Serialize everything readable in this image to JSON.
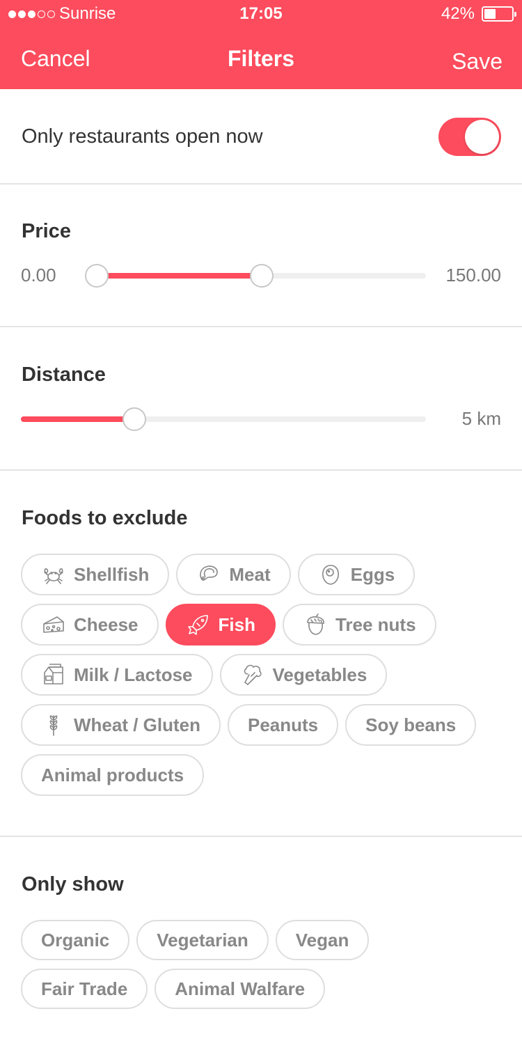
{
  "status_bar": {
    "carrier": "Sunrise",
    "time": "17:05",
    "battery": "42%",
    "battery_level": 0.42,
    "signal_bars_filled": 3,
    "signal_bars_total": 5
  },
  "nav": {
    "cancel": "Cancel",
    "title": "Filters",
    "save": "Save"
  },
  "open_now": {
    "label": "Only restaurants open now",
    "enabled": true
  },
  "price": {
    "title": "Price",
    "min_label": "0.00",
    "max_label": "150.00",
    "range_min": 0,
    "range_max": 150,
    "selected_low": 0,
    "selected_high": 75
  },
  "distance": {
    "title": "Distance",
    "value_label": "5 km",
    "level": 0.28
  },
  "foods_to_exclude": {
    "title": "Foods to exclude",
    "items": [
      {
        "label": "Shellfish",
        "icon": "crab-icon",
        "selected": false
      },
      {
        "label": "Meat",
        "icon": "steak-icon",
        "selected": false
      },
      {
        "label": "Eggs",
        "icon": "egg-icon",
        "selected": false
      },
      {
        "label": "Cheese",
        "icon": "cheese-icon",
        "selected": false
      },
      {
        "label": "Fish",
        "icon": "fish-icon",
        "selected": true
      },
      {
        "label": "Tree nuts",
        "icon": "acorn-icon",
        "selected": false
      },
      {
        "label": "Milk / Lactose",
        "icon": "milk-carton-icon",
        "selected": false
      },
      {
        "label": "Vegetables",
        "icon": "broccoli-icon",
        "selected": false
      },
      {
        "label": "Wheat / Gluten",
        "icon": "wheat-icon",
        "selected": false
      },
      {
        "label": "Peanuts",
        "icon": "",
        "selected": false
      },
      {
        "label": "Soy beans",
        "icon": "",
        "selected": false
      },
      {
        "label": "Animal products",
        "icon": "",
        "selected": false
      }
    ]
  },
  "only_show": {
    "title": "Only show",
    "items": [
      {
        "label": "Organic",
        "selected": false
      },
      {
        "label": "Vegetarian",
        "selected": false
      },
      {
        "label": "Vegan",
        "selected": false
      },
      {
        "label": "Fair Trade",
        "selected": false
      },
      {
        "label": "Animal Walfare",
        "selected": false
      }
    ]
  },
  "colors": {
    "accent": "#fc4c5d",
    "chip_text": "#888888",
    "chip_border": "#dedede",
    "divider": "#e4e4e4"
  }
}
